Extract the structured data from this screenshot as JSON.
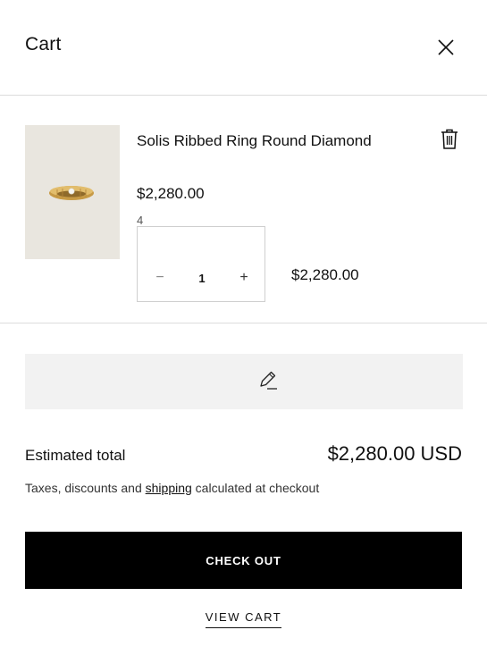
{
  "header": {
    "title": "Cart",
    "close_icon": "close-icon"
  },
  "item": {
    "name": "Solis Ribbed Ring Round Diamond",
    "unit_price": "$2,280.00",
    "variant": "4",
    "quantity": "1",
    "line_total": "$2,280.00",
    "image_icon": "gold-ring-icon",
    "remove_icon": "trash-icon",
    "minus_icon": "minus-icon",
    "plus_icon": "plus-icon"
  },
  "note": {
    "icon": "pencil-icon"
  },
  "summary": {
    "estimated_label": "Estimated total",
    "estimated_total": "$2,280.00 USD",
    "tax_prefix": "Taxes, discounts and ",
    "tax_link": "shipping",
    "tax_suffix": " calculated at checkout"
  },
  "actions": {
    "checkout_label": "CHECK OUT",
    "view_cart_label": "VIEW CART"
  },
  "colors": {
    "checkout_bg": "#000000",
    "note_bg": "#f2f2f2",
    "thumb_bg": "#e9e6df"
  }
}
